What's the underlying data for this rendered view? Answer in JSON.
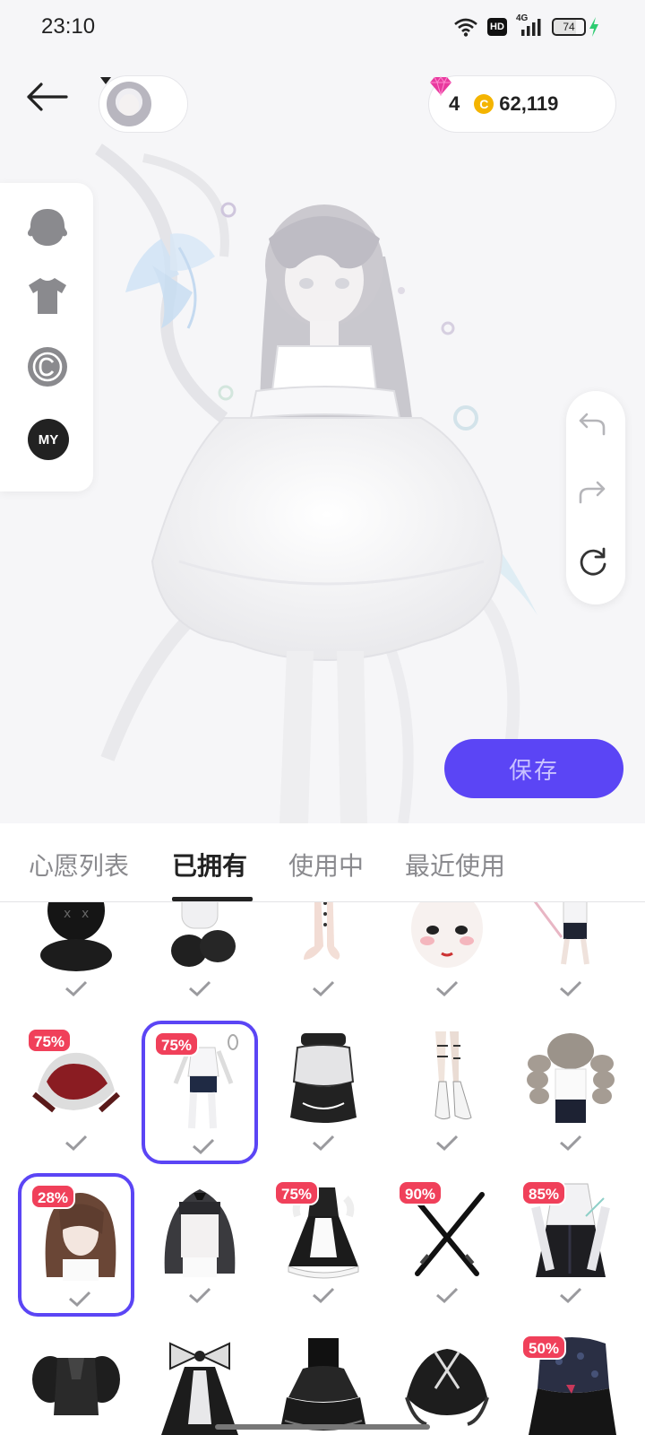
{
  "status_bar": {
    "time": "23:10",
    "network_label": "4G",
    "hd_label": "HD",
    "battery": "74",
    "icons": [
      "wifi-icon",
      "hd-icon",
      "signal-icon",
      "battery-icon",
      "charging-icon"
    ]
  },
  "header": {
    "back_icon": "arrow-left-icon",
    "avatar_switch_icon": "caret-down-icon",
    "gems": "4",
    "coin_symbol": "C",
    "coins": "62,119"
  },
  "category_panel": {
    "items": [
      {
        "name": "head",
        "icon": "head-icon"
      },
      {
        "name": "outfit",
        "icon": "tshirt-icon"
      },
      {
        "name": "copyright",
        "icon": "copyright-icon"
      },
      {
        "name": "my",
        "label": "MY"
      }
    ]
  },
  "history_panel": {
    "icons": [
      "undo-icon",
      "redo-icon",
      "reset-icon"
    ]
  },
  "save_label": "保存",
  "tabs": [
    {
      "label": "心愿列表",
      "active": false
    },
    {
      "label": "已拥有",
      "active": true
    },
    {
      "label": "使用中",
      "active": false
    },
    {
      "label": "最近使用",
      "active": false
    }
  ],
  "items_row1": [
    {
      "name": "black-plush-doll",
      "discount": ""
    },
    {
      "name": "white-fluffy-boots",
      "discount": ""
    },
    {
      "name": "laced-stockings",
      "discount": ""
    },
    {
      "name": "doll-face",
      "discount": ""
    },
    {
      "name": "cropped-outfit",
      "discount": ""
    }
  ],
  "items_row2": [
    {
      "name": "red-horned-hood",
      "discount": "75%"
    },
    {
      "name": "white-shirt-shorts",
      "discount": "75%"
    },
    {
      "name": "black-corset-top",
      "discount": ""
    },
    {
      "name": "skeleton-leg",
      "discount": ""
    },
    {
      "name": "twin-drill-hair",
      "discount": ""
    }
  ],
  "items_row3": [
    {
      "name": "brown-long-hair",
      "discount": "28%"
    },
    {
      "name": "black-hime-hair",
      "discount": ""
    },
    {
      "name": "maid-dress",
      "discount": "75%"
    },
    {
      "name": "crossed-katanas",
      "discount": "90%"
    },
    {
      "name": "black-white-robe",
      "discount": "85%"
    }
  ],
  "items_row4": [
    {
      "name": "black-puff-top",
      "discount": ""
    },
    {
      "name": "bow-gothic-dress",
      "discount": ""
    },
    {
      "name": "black-tiered-skirt",
      "discount": ""
    },
    {
      "name": "black-lace-cape",
      "discount": ""
    },
    {
      "name": "gothic-lolita-dress",
      "discount": "50%"
    }
  ]
}
